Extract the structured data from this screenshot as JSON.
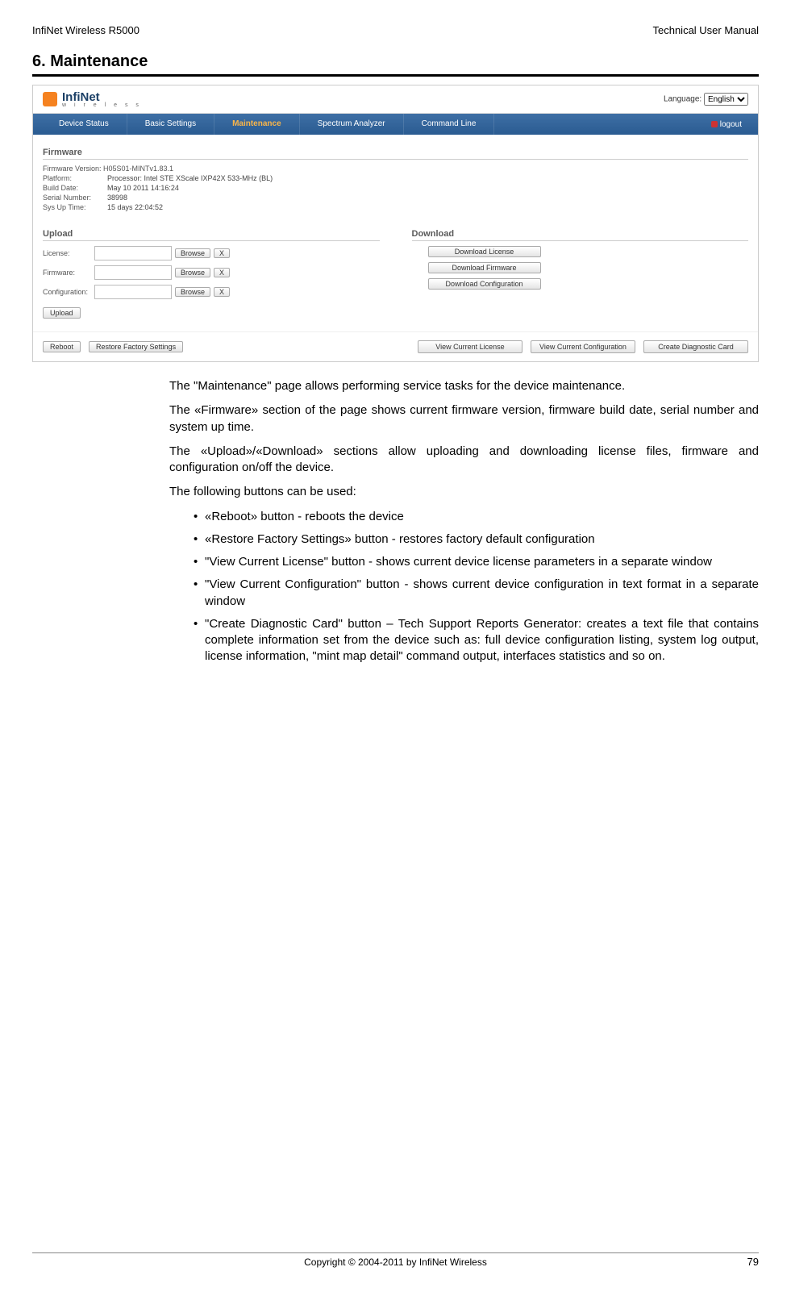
{
  "header": {
    "left": "InfiNet Wireless R5000",
    "right": "Technical User Manual"
  },
  "section_title": "6. Maintenance",
  "ui": {
    "logo": {
      "line1": "InfiNet",
      "line2": "w i r e l e s s"
    },
    "language_label": "Language:",
    "language_value": "English",
    "tabs": [
      "Device Status",
      "Basic Settings",
      "Maintenance",
      "Spectrum Analyzer",
      "Command Line"
    ],
    "logout": "logout",
    "firmware_hdr": "Firmware",
    "fw_version_row": "Firmware Version: H05S01-MINTv1.83.1",
    "fw_rows": [
      {
        "label": "Platform:",
        "value": "Processor: Intel STE XScale IXP42X 533-MHz (BL)"
      },
      {
        "label": "Build Date:",
        "value": "May 10 2011 14:16:24"
      },
      {
        "label": "Serial Number:",
        "value": "38998"
      },
      {
        "label": "Sys Up Time:",
        "value": "15 days 22:04:52"
      }
    ],
    "upload_hdr": "Upload",
    "download_hdr": "Download",
    "upload_rows": [
      "License:",
      "Firmware:",
      "Configuration:"
    ],
    "browse_btn": "Browse",
    "x_btn": "X",
    "download_btns": [
      "Download License",
      "Download Firmware",
      "Download Configuration"
    ],
    "upload_btn": "Upload",
    "bottom_left": [
      "Reboot",
      "Restore Factory Settings"
    ],
    "bottom_right": [
      "View Current License",
      "View Current Configuration",
      "Create Diagnostic Card"
    ]
  },
  "paras": [
    "The \"Maintenance\" page allows performing service tasks for the device maintenance.",
    "The «Firmware» section of the page shows current firmware version, firmware build date, serial number and system up time.",
    " The «Upload»/«Download» sections allow uploading and downloading license files, firmware and configuration on/off the device.",
    "The following buttons can be used:"
  ],
  "bullets": [
    "«Reboot» button - reboots the device",
    "«Restore Factory Settings» button - restores factory default configuration",
    " \"View Current License\" button - shows current device license parameters in a separate window",
    "\"View Current Configuration\" button - shows current device configuration in text format in a separate window",
    "\"Create Diagnostic Card\" button – Tech Support Reports Generator: creates a text file that contains complete information set from the device such as: full device configuration listing, system log output, license information, \"mint map detail\" command output, interfaces statistics and so on."
  ],
  "footer": {
    "copyright": "Copyright © 2004-2011 by InfiNet Wireless",
    "page_num": "79"
  }
}
